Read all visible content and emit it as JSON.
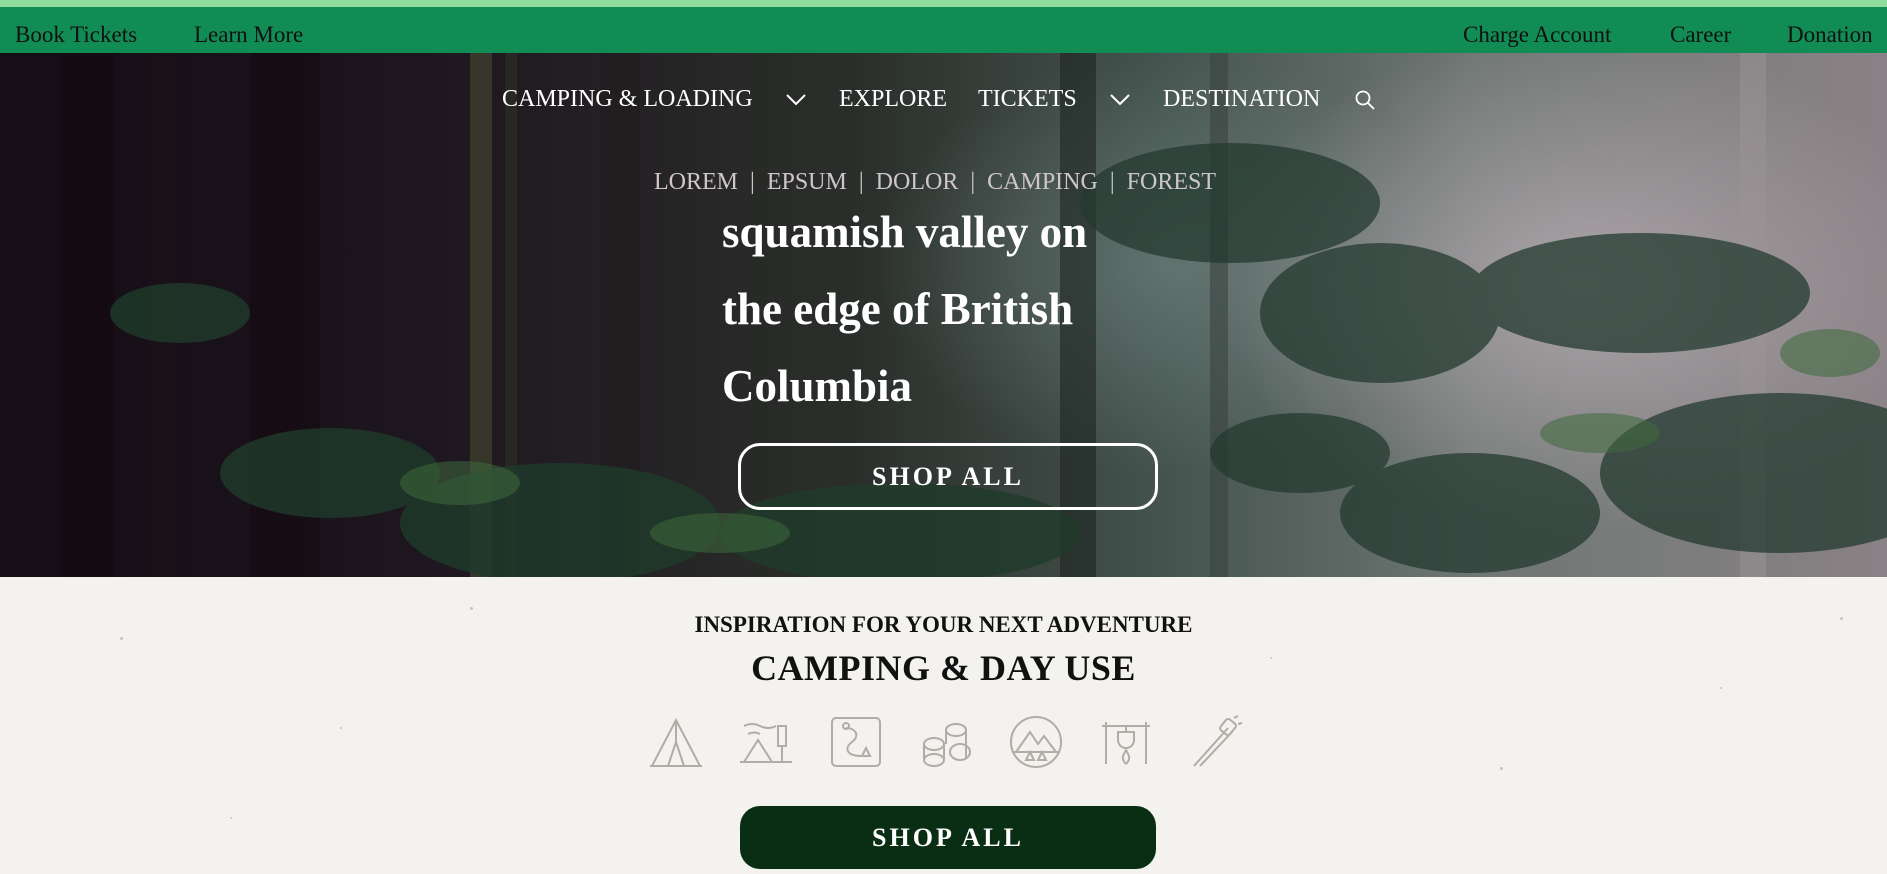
{
  "topbar": {
    "left_links": [
      "Book Tickets",
      "Learn More"
    ],
    "right_links": [
      "Charge Account",
      "Career",
      "Donation"
    ]
  },
  "nav": {
    "items": [
      {
        "label": "CAMPING & LOADING",
        "has_dropdown": true
      },
      {
        "label": "EXPLORE",
        "has_dropdown": false
      },
      {
        "label": "TICKETS",
        "has_dropdown": true
      },
      {
        "label": "DESTINATION",
        "has_dropdown": false
      }
    ],
    "search_icon": "search-icon"
  },
  "hero": {
    "categories": [
      "LOREM",
      "EPSUM",
      "DOLOR",
      "CAMPING",
      "FOREST"
    ],
    "separator": "|",
    "headline_lines": [
      "squamish valley on",
      "the edge of British",
      "Columbia"
    ],
    "cta_label": "SHOP ALL"
  },
  "section": {
    "subtitle": "INSPIRATION FOR YOUR NEXT ADVENTURE",
    "title": "CAMPING & DAY USE",
    "icons": [
      "tent-icon",
      "campsite-icon",
      "trail-map-icon",
      "firewood-icon",
      "mountain-badge-icon",
      "campfire-cooking-icon",
      "marshmallow-roast-icon"
    ],
    "cta_label": "SHOP ALL"
  },
  "colors": {
    "topbar_bg": "#128c55",
    "topbar_accent": "#8fdc9e",
    "solid_button": "#0a2e14",
    "page_bg": "#f4f2ee"
  }
}
